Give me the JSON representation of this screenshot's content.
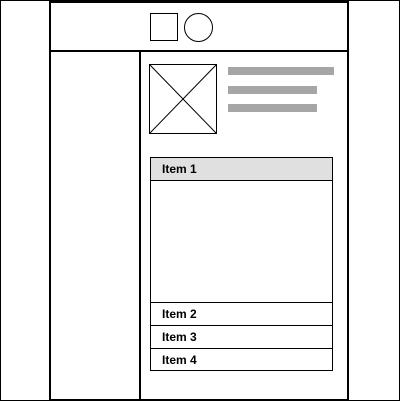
{
  "header": {
    "icons": [
      "square-icon",
      "circle-icon"
    ]
  },
  "content": {
    "image_icon": "image-placeholder-icon",
    "text_placeholder_lines": 3
  },
  "accordion": {
    "items": [
      {
        "label": "Item 1",
        "expanded": true
      },
      {
        "label": "Item 2",
        "expanded": false
      },
      {
        "label": "Item 3",
        "expanded": false
      },
      {
        "label": "Item 4",
        "expanded": false
      }
    ]
  },
  "colors": {
    "line": "#000000",
    "placeholder_text": "#a6a6a6",
    "active_item_bg": "#e0e0e0",
    "background": "#ffffff"
  }
}
